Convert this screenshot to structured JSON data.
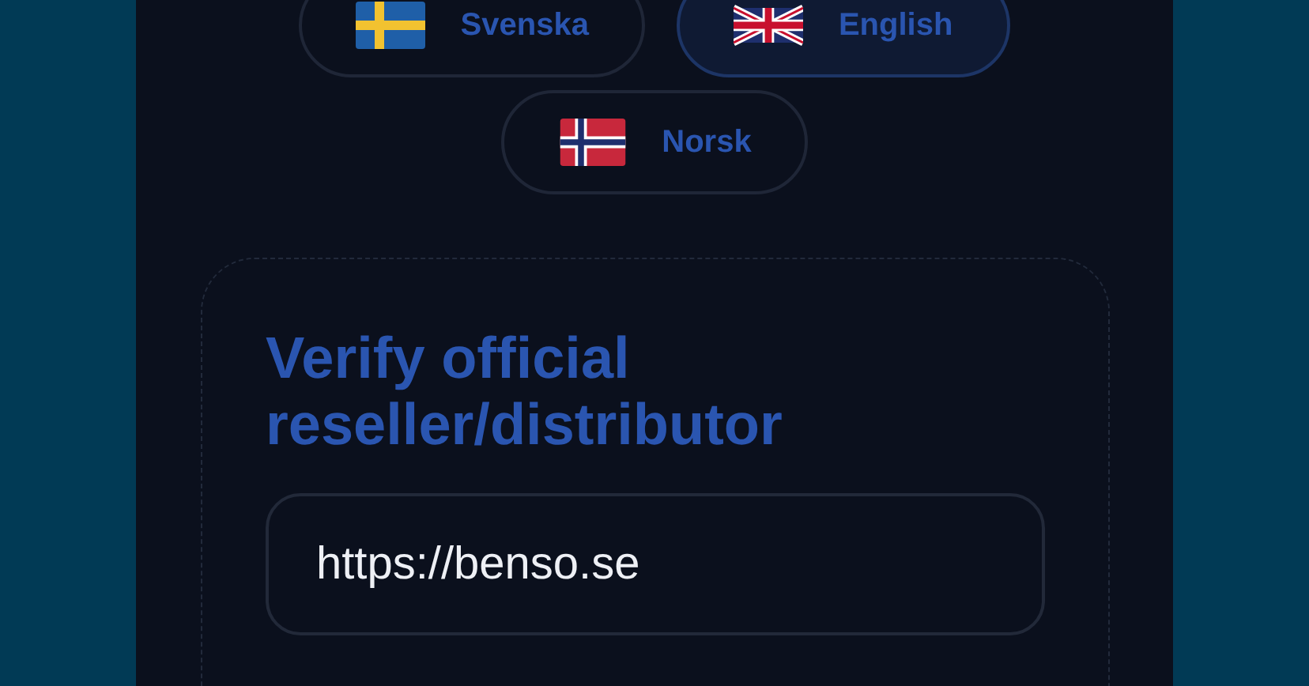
{
  "languages": [
    {
      "label": "Svenska",
      "kind": "sweden",
      "selected": false
    },
    {
      "label": "English",
      "kind": "uk",
      "selected": true
    },
    {
      "label": "Norsk",
      "kind": "norway",
      "selected": false
    }
  ],
  "verify": {
    "title": "Verify official reseller/distributor",
    "url_field": {
      "value": "https://benso.se"
    }
  }
}
